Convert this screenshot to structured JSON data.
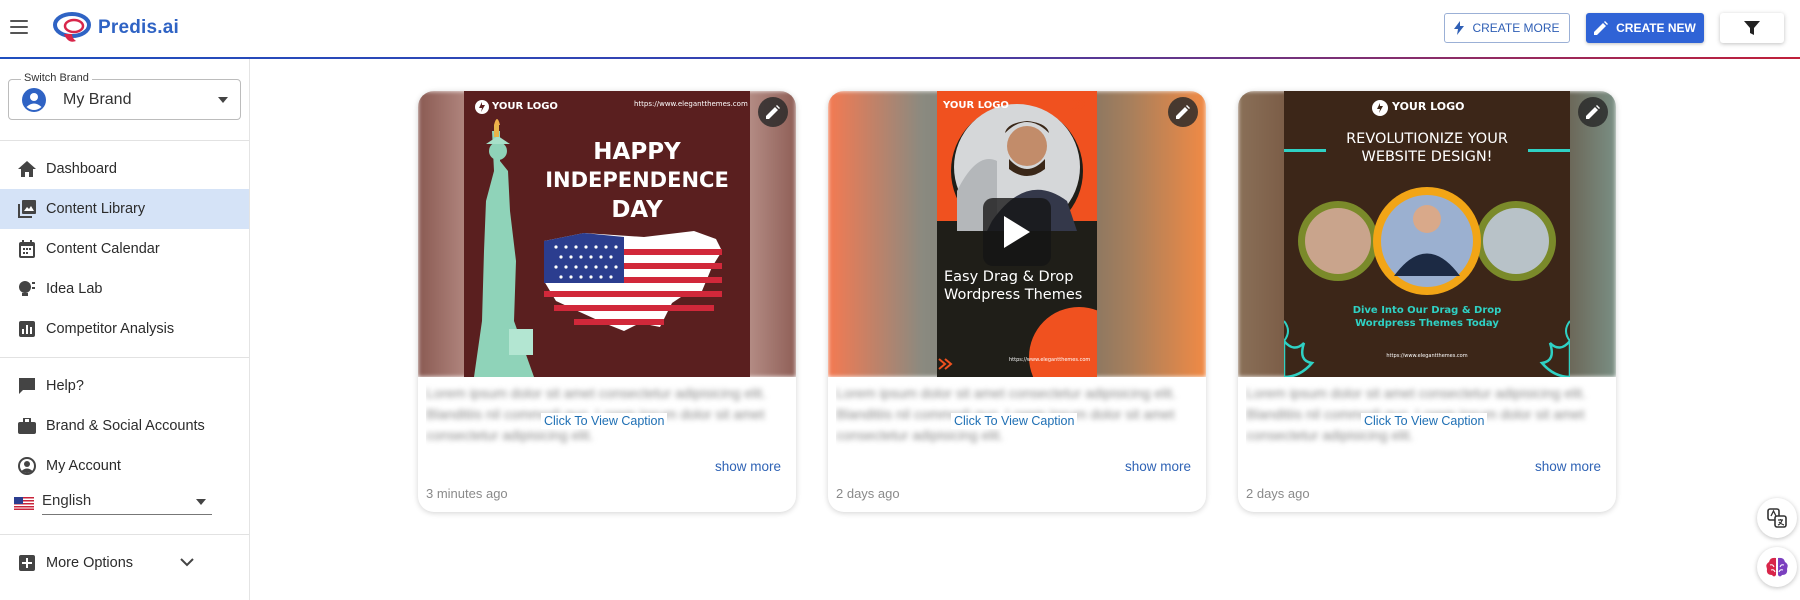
{
  "app": {
    "logo_text": "Predis.ai"
  },
  "toolbar": {
    "create_more_label": "CREATE MORE",
    "create_new_label": "CREATE NEW"
  },
  "sidebar": {
    "switch_brand_label": "Switch Brand",
    "brand_name": "My Brand",
    "items": [
      {
        "label": "Dashboard",
        "icon": "home-icon"
      },
      {
        "label": "Content Library",
        "icon": "library-icon",
        "active": true
      },
      {
        "label": "Content Calendar",
        "icon": "calendar-icon"
      },
      {
        "label": "Idea Lab",
        "icon": "bulb-icon"
      },
      {
        "label": "Competitor Analysis",
        "icon": "analytics-icon"
      }
    ],
    "secondary": [
      {
        "label": "Help?",
        "icon": "chat-icon"
      },
      {
        "label": "Brand & Social Accounts",
        "icon": "briefcase-icon"
      },
      {
        "label": "My Account",
        "icon": "account-icon"
      }
    ],
    "language": "English",
    "more_options": "More Options"
  },
  "cards": [
    {
      "poster": {
        "logo": "YOUR LOGO",
        "url": "https://www.elegantthemes.com",
        "headline": [
          "HAPPY",
          "INDEPENDENCE",
          "DAY"
        ]
      },
      "caption_placeholder": "Lorem ipsum dolor sit amet consectetur adipisicing elit. Blanditiis nil commodi quo. Lorem ipsum dolor sit amet consectetur adipisicing elit.",
      "caption_link": "Click To View Caption",
      "show_more": "show more",
      "time": "3 minutes ago"
    },
    {
      "poster": {
        "logo": "YOUR LOGO",
        "headline": [
          "Easy Drag & Drop",
          "Wordpress Themes"
        ],
        "url": "https://www.elegantthemes.com"
      },
      "caption_placeholder": "Lorem ipsum dolor sit amet consectetur adipisicing elit. Blanditiis nil commodi quo. Lorem ipsum dolor sit amet consectetur adipisicing elit.",
      "caption_link": "Click To View Caption",
      "show_more": "show more",
      "time": "2 days ago"
    },
    {
      "poster": {
        "logo": "YOUR LOGO",
        "headline": [
          "REVOLUTIONIZE YOUR",
          "WEBSITE DESIGN!"
        ],
        "subline": [
          "Dive Into Our Drag & Drop",
          "Wordpress Themes Today"
        ],
        "url": "https://www.elegantthemes.com"
      },
      "caption_placeholder": "Lorem ipsum dolor sit amet consectetur adipisicing elit. Blanditiis nil commodi quo. Lorem ipsum dolor sit amet consectetur adipisicing elit.",
      "caption_link": "Click To View Caption",
      "show_more": "show more",
      "time": "2 days ago"
    }
  ],
  "colors": {
    "accent": "#2f63d6",
    "active_nav": "#d5e3f7",
    "poster1_bg": "#5a1f1f",
    "poster2_bg": "#1f1e18",
    "poster2_orange": "#f0511f",
    "poster3_bg": "#3c2618",
    "poster3_teal": "#2fd1c4"
  }
}
